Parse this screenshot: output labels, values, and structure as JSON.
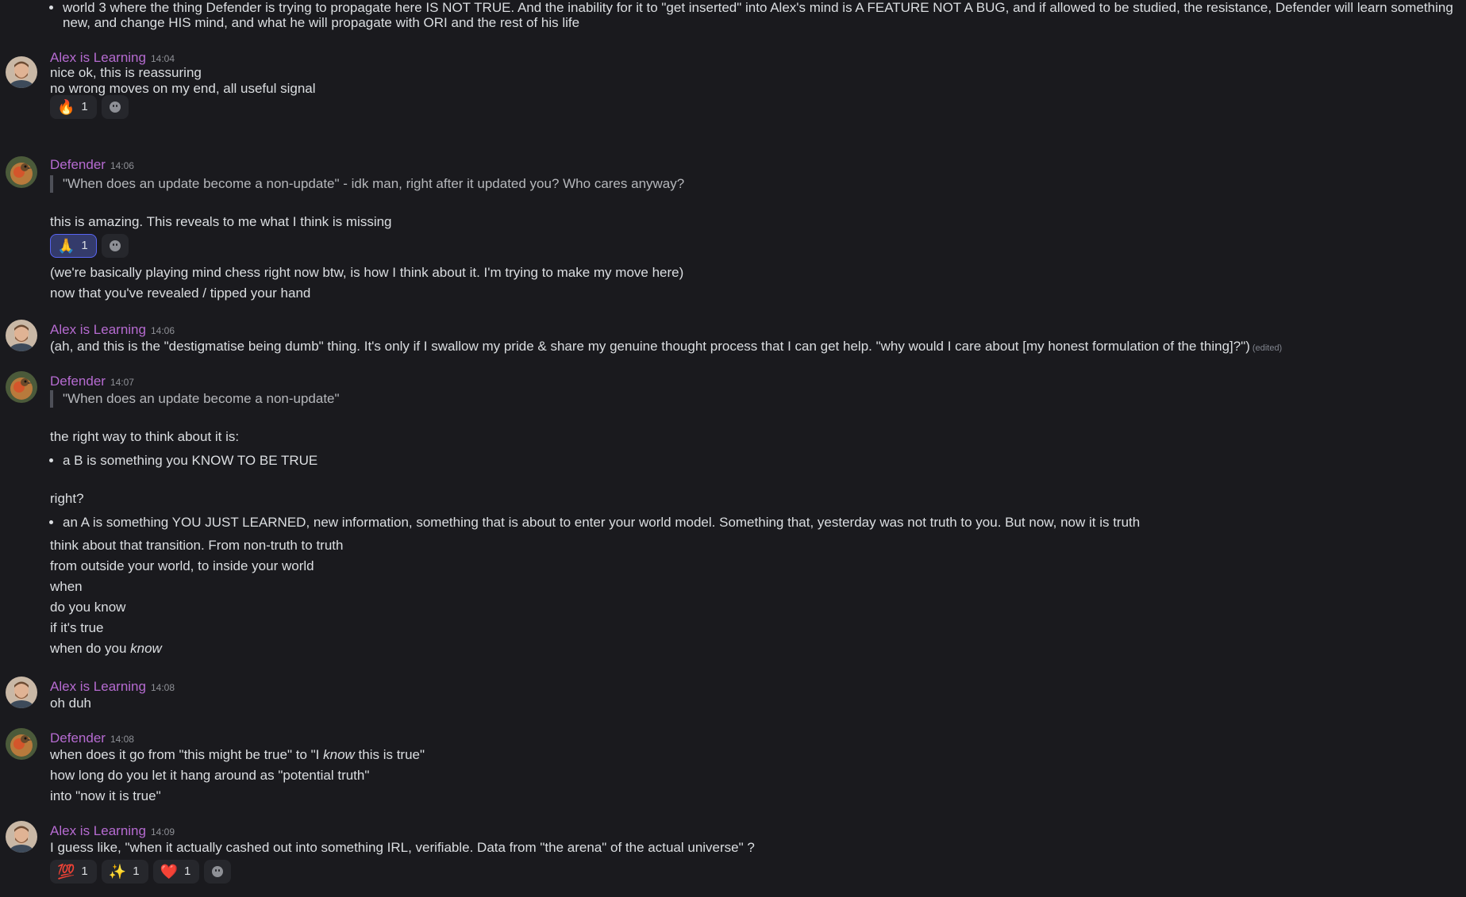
{
  "top_bullet": "world 3 where the thing Defender is trying to propagate here IS NOT TRUE. And the inability for it to \"get inserted\" into Alex's mind is A FEATURE NOT A BUG, and if allowed to be studied, the resistance, Defender will learn something new, and change HIS mind, and what he will propagate with ORI and the rest of his life",
  "colors": {
    "background": "#1a1a1e",
    "author": "#b66bd1",
    "text": "#dbdee1",
    "active_reaction": "#5865f2"
  },
  "messages": [
    {
      "author": "Alex is Learning",
      "time": "14:04",
      "lines": [
        "nice ok, this is reassuring",
        "no wrong moves on my end, all useful signal"
      ],
      "reactions": [
        {
          "emoji": "🔥",
          "count": "1",
          "icon": "fire-icon"
        }
      ]
    },
    {
      "author": "Defender",
      "time": "14:06",
      "quote": "\"When does an update become a non-update\" - idk man, right after it updated you? Who cares anyway?",
      "line1": "this is amazing. This reveals to me what I think is missing",
      "reactions": [
        {
          "emoji": "🙏",
          "count": "1",
          "icon": "pray-icon"
        }
      ],
      "lines2": [
        "(we're basically playing mind chess right now btw, is how I think about it. I'm trying to make my move here)",
        "now that you've revealed / tipped your hand"
      ]
    },
    {
      "author": "Alex is Learning",
      "time": "14:06",
      "text": "(ah, and this is the \"destigmatise being dumb\" thing. It's only if I swallow my pride & share my genuine thought process that I can get help. \"why would I care about [my honest formulation of the thing]?\")",
      "edited": "(edited)"
    },
    {
      "author": "Defender",
      "time": "14:07",
      "quote": "\"When does an update become a non-update\"",
      "intro": "the right way to think about it is:",
      "bullet1": "a B is something you KNOW TO BE TRUE",
      "right": "right?",
      "bullet2": "an A is something YOU JUST LEARNED, new information, something that is about to enter your world model. Something that, yesterday was not truth to you. But now, now it is truth",
      "lines": [
        "think about that transition. From non-truth to truth",
        "from outside your world, to inside your world",
        "when",
        "do you know",
        "if it's true"
      ],
      "last_prefix": "when do you ",
      "last_em": "know"
    },
    {
      "author": "Alex is Learning",
      "time": "14:08",
      "text": "oh duh"
    },
    {
      "author": "Defender",
      "time": "14:08",
      "l1_prefix": "when does it go from \"this might be true\" to \"I ",
      "l1_em": "know",
      "l1_suffix": " this is true\"",
      "lines": [
        "how long do you let it hang around as \"potential truth\"",
        "into \"now it is true\""
      ]
    },
    {
      "author": "Alex is Learning",
      "time": "14:09",
      "text": "I guess like, \"when it actually cashed out into something IRL, verifiable. Data from \"the arena\" of the actual universe\" ?",
      "reactions": [
        {
          "emoji": "💯",
          "count": "1",
          "icon": "hundred-points-icon"
        },
        {
          "emoji": "✨",
          "count": "1",
          "icon": "sparkles-icon"
        },
        {
          "emoji": "❤️",
          "count": "1",
          "icon": "heart-icon"
        }
      ]
    }
  ]
}
